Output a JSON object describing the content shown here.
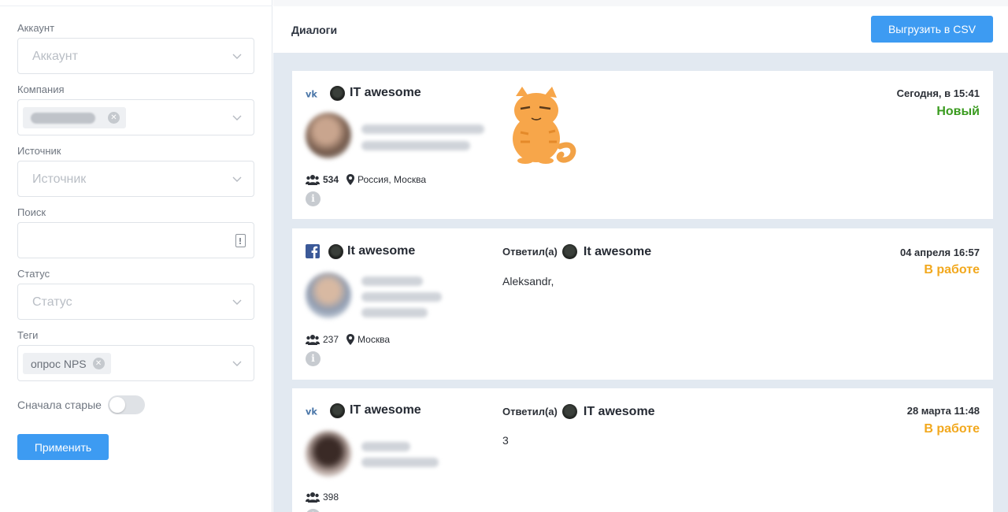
{
  "colors": {
    "accent": "#3d9bf2",
    "status_new": "#3a9b1f",
    "status_in_work": "#f2a81d"
  },
  "sidebar": {
    "account": {
      "label": "Аккаунт",
      "placeholder": "Аккаунт"
    },
    "company": {
      "label": "Компания"
    },
    "source": {
      "label": "Источник",
      "placeholder": "Источник"
    },
    "search": {
      "label": "Поиск",
      "value": ""
    },
    "status": {
      "label": "Статус",
      "placeholder": "Статус"
    },
    "tags": {
      "label": "Теги",
      "chip": "опрос NPS"
    },
    "sort_toggle": {
      "label": "Сначала старые"
    },
    "apply_label": "Применить"
  },
  "main": {
    "title": "Диалоги",
    "export_label": "Выгрузить в CSV",
    "dialogs": [
      {
        "source_icon": "vk-icon",
        "account": "IT awesome",
        "followers": "534",
        "location": "Россия, Москва",
        "date": "Сегодня, в 15:41",
        "status": "Новый",
        "message_type": "cat-sticker"
      },
      {
        "source_icon": "facebook-icon",
        "account": "It awesome",
        "replied_label": "Ответил(а)",
        "replied_account": "It awesome",
        "message": "Aleksandr,",
        "followers": "237",
        "location": "Москва",
        "date": "04 апреля 16:57",
        "status": "В работе"
      },
      {
        "source_icon": "vk-icon",
        "account": "IT awesome",
        "replied_label": "Ответил(а)",
        "replied_account": "IT awesome",
        "message": "3",
        "followers": "398",
        "date": "28 марта 11:48",
        "status": "В работе"
      }
    ]
  }
}
